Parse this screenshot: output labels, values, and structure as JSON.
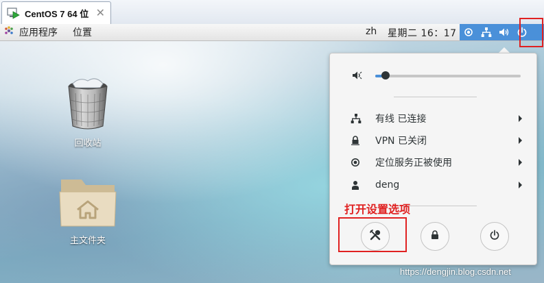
{
  "vm_tab": {
    "title": "CentOS 7 64 位",
    "close_glyph": "✕"
  },
  "topbar": {
    "apps_label": "应用程序",
    "places_label": "位置",
    "language": "zh",
    "clock": "星期二 16：17",
    "status_icons": [
      "location-icon",
      "network-icon",
      "volume-icon",
      "power-icon"
    ]
  },
  "desktop": {
    "icons": [
      {
        "label": "回收站",
        "icon": "trash-icon"
      },
      {
        "label": "主文件夹",
        "icon": "home-folder-icon"
      }
    ]
  },
  "menu": {
    "volume_level": 0.07,
    "items": [
      {
        "icon": "wired-network-icon",
        "label": "有线 已连接"
      },
      {
        "icon": "vpn-lock-icon",
        "label": "VPN 已关闭"
      },
      {
        "icon": "location-icon",
        "label": "定位服务正被使用"
      },
      {
        "icon": "user-icon",
        "label": "deng"
      }
    ],
    "buttons": [
      "settings-icon",
      "lock-icon",
      "power-icon"
    ]
  },
  "annotation": {
    "text": "打开设置选项",
    "color": "#e02020"
  },
  "watermark": "https://dengjin.blog.csdn.net",
  "colors": {
    "accent": "#4a90d9",
    "highlight": "#e02020",
    "text": "#2e3436"
  }
}
